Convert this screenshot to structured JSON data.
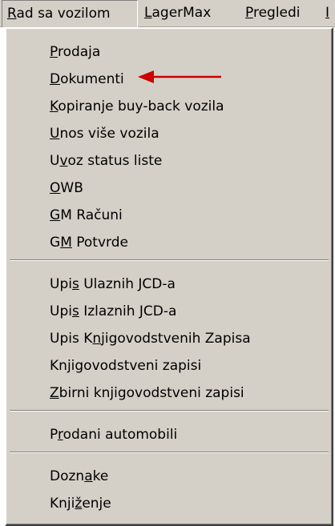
{
  "menubar": {
    "items": [
      {
        "pre": "",
        "u": "R",
        "post": "ad sa vozilom"
      },
      {
        "pre": "",
        "u": "L",
        "post": "agerMax"
      },
      {
        "pre": "",
        "u": "P",
        "post": "regledi"
      },
      {
        "pre": "",
        "u": "I",
        "post": ""
      }
    ]
  },
  "menu": {
    "items": [
      {
        "pre": "",
        "u": "P",
        "post": "rodaja"
      },
      {
        "pre": "",
        "u": "D",
        "post": "okumenti"
      },
      {
        "pre": "",
        "u": "K",
        "post": "opiranje buy-back vozila"
      },
      {
        "pre": "",
        "u": "U",
        "post": "nos više vozila"
      },
      {
        "pre": "U",
        "u": "v",
        "post": "oz status liste"
      },
      {
        "pre": "",
        "u": "O",
        "post": "WB"
      },
      {
        "pre": "",
        "u": "G",
        "post": "M Računi"
      },
      {
        "pre": "G",
        "u": "M",
        "post": " Potvrde"
      },
      {
        "pre": "Upi",
        "u": "s",
        "post": " Ulaznih JCD-a"
      },
      {
        "pre": "Upi",
        "u": "s",
        "post": " Izlaznih JCD-a"
      },
      {
        "pre": "Upis K",
        "u": "n",
        "post": "jigovodstvenih Zapisa"
      },
      {
        "pre": "Kn",
        "u": "j",
        "post": "igovodstveni zapisi"
      },
      {
        "pre": "",
        "u": "Z",
        "post": "birni knjigovodstveni zapisi"
      },
      {
        "pre": "P",
        "u": "r",
        "post": "odani automobili"
      },
      {
        "pre": "Dozn",
        "u": "a",
        "post": "ke"
      },
      {
        "pre": "Knji",
        "u": "ž",
        "post": "enje"
      }
    ]
  },
  "annotation": {
    "arrow_color": "#cc0000"
  }
}
